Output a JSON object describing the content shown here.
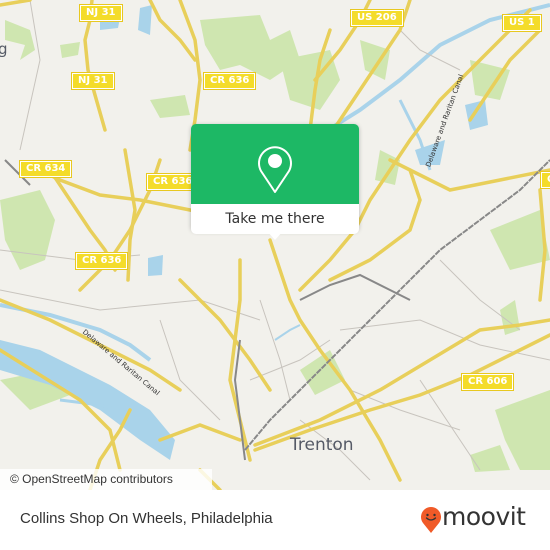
{
  "map": {
    "road_labels": [
      {
        "id": "nj31-top",
        "text": "NJ 31"
      },
      {
        "id": "nj31-mid",
        "text": "NJ 31"
      },
      {
        "id": "us206",
        "text": "US 206"
      },
      {
        "id": "us1",
        "text": "US 1"
      },
      {
        "id": "cr636-top",
        "text": "CR 636"
      },
      {
        "id": "cr634",
        "text": "CR 634"
      },
      {
        "id": "cr636-mid",
        "text": "CR 636"
      },
      {
        "id": "cr636-left",
        "text": "CR 636"
      },
      {
        "id": "cr606",
        "text": "CR 606"
      },
      {
        "id": "cr-edge",
        "text": "C"
      }
    ],
    "place_labels": [
      {
        "id": "trenton",
        "text": "Trenton"
      },
      {
        "id": "edge-g",
        "text": "g"
      }
    ],
    "water_labels": [
      {
        "id": "canal-ne",
        "text": "Delaware and Raritan Canal"
      },
      {
        "id": "canal-sw",
        "text": "Delaware and Raritan Canal"
      }
    ],
    "attribution": "© OpenStreetMap contributors",
    "colors": {
      "land": "#f2f1ec",
      "park": "#cfe6b0",
      "water": "#a9d3ea",
      "road_major": "#f6e27a",
      "road_minor": "#c8c4be",
      "rail": "#777777"
    }
  },
  "popup": {
    "icon": "map-pin-icon",
    "button_label": "Take me there",
    "color": "#1db865"
  },
  "footer": {
    "title": "Collins Shop On Wheels, Philadelphia",
    "brand": "moovit",
    "brand_color": "#f05a28"
  }
}
